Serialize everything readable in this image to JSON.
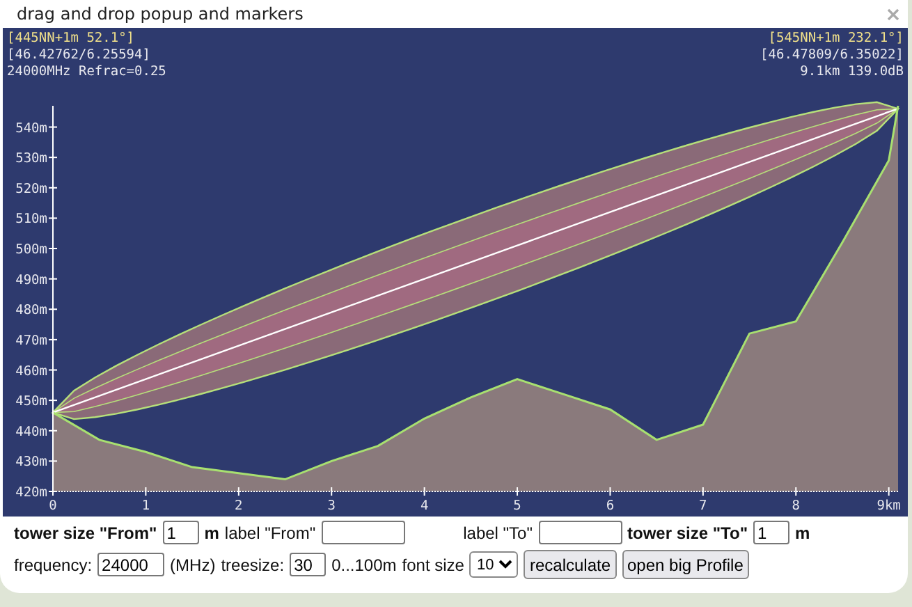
{
  "window": {
    "title": "drag and drop popup and markers"
  },
  "profile": {
    "from": {
      "header": "[445NN+1m 52.1°]",
      "coords": "[46.42762/6.25594]"
    },
    "to": {
      "header": "[545NN+1m 232.1°]",
      "coords": "[46.47809/6.35022]"
    },
    "settings_line": "24000MHz Refrac=0.25",
    "summary": "9.1km 139.0dB",
    "chart_data": {
      "type": "area",
      "x": [
        0,
        0.5,
        1,
        1.5,
        2,
        2.5,
        3,
        3.5,
        4,
        4.5,
        5,
        5.5,
        6,
        6.5,
        7,
        7.5,
        8,
        8.5,
        9,
        9.1
      ],
      "series": [
        {
          "color": "#8a7a7c",
          "values": [
            446,
            437,
            433,
            428,
            426,
            424,
            430,
            435,
            444,
            451,
            457,
            452,
            447,
            437,
            442,
            472,
            476,
            502,
            529,
            547
          ]
        },
        {
          "type": "line",
          "color": "#ffffff",
          "values": [
            446,
            451.5,
            457,
            462.5,
            468,
            473.5,
            479,
            484.5,
            490,
            495.5,
            501,
            506.5,
            512,
            517.5,
            523,
            528.5,
            534,
            539.5,
            545,
            546
          ]
        }
      ],
      "xlim": [
        0,
        9.1
      ],
      "ylim": [
        420,
        547
      ],
      "xticks": [
        0,
        1,
        2,
        3,
        4,
        5,
        6,
        7,
        8,
        {
          "value": 9,
          "label": "9km"
        }
      ],
      "yticks": [
        {
          "value": 420,
          "label": "420m"
        },
        {
          "value": 430,
          "label": "430m"
        },
        {
          "value": 440,
          "label": "440m"
        },
        {
          "value": 450,
          "label": "450m"
        },
        {
          "value": 460,
          "label": "460m"
        },
        {
          "value": 470,
          "label": "470m"
        },
        {
          "value": 480,
          "label": "480m"
        },
        {
          "value": 490,
          "label": "490m"
        },
        {
          "value": 500,
          "label": "500m"
        },
        {
          "value": 510,
          "label": "510m"
        },
        {
          "value": 520,
          "label": "520m"
        },
        {
          "value": 530,
          "label": "530m"
        },
        {
          "value": 540,
          "label": "540m"
        }
      ]
    }
  },
  "form": [
    {
      "items": [
        {
          "kind": "label",
          "text": "tower size \"From\"",
          "bold": true
        },
        {
          "kind": "input",
          "value": "1"
        },
        {
          "kind": "label",
          "text": "m",
          "bold": true
        },
        {
          "kind": "label",
          "text": "label \"From\"",
          "bold": false
        },
        {
          "kind": "input"
        },
        {
          "kind": "spacer"
        },
        {
          "kind": "label",
          "text": "label \"To\"",
          "bold": false
        },
        {
          "kind": "input"
        },
        {
          "kind": "label",
          "text": "tower size \"To\"",
          "bold": true
        },
        {
          "kind": "input",
          "value": "1"
        },
        {
          "kind": "label",
          "text": "m",
          "bold": true
        }
      ]
    },
    {
      "items": [
        {
          "kind": "label",
          "text": "frequency:",
          "bold": false
        },
        {
          "kind": "input",
          "value": "24000"
        },
        {
          "kind": "label",
          "text": "(MHz)",
          "bold": false
        },
        {
          "kind": "label",
          "text": "treesize:",
          "bold": false
        },
        {
          "kind": "input",
          "value": "30"
        },
        {
          "kind": "label",
          "text": "0...100m",
          "bold": false
        },
        {
          "kind": "label",
          "text": "font size",
          "bold": false
        },
        {
          "kind": "select",
          "value": "10"
        },
        {
          "kind": "button",
          "text": "recalculate"
        },
        {
          "kind": "button",
          "text": "open big Profile"
        }
      ]
    }
  ]
}
